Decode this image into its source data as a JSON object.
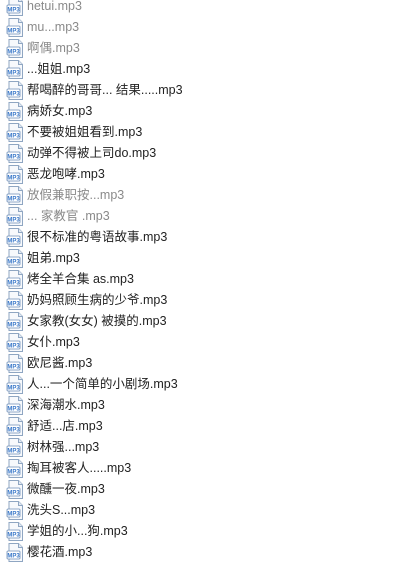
{
  "icon": {
    "type": "mp3-file-icon",
    "label": "MP3",
    "accent": "#3a78c9"
  },
  "files": [
    {
      "name": "hetui.mp3",
      "faded": true
    },
    {
      "name": "mu...mp3",
      "faded": true
    },
    {
      "name": "啊偶.mp3",
      "faded": true
    },
    {
      "name": "...姐姐.mp3",
      "faded": false
    },
    {
      "name": "帮喝醉的哥哥... 结果.....mp3",
      "faded": false
    },
    {
      "name": "病娇女.mp3",
      "faded": false
    },
    {
      "name": "不要被姐姐看到.mp3",
      "faded": false
    },
    {
      "name": "动弹不得被上司do.mp3",
      "faded": false
    },
    {
      "name": "恶龙咆哮.mp3",
      "faded": false
    },
    {
      "name": "放假兼职按...mp3",
      "faded": true
    },
    {
      "name": "... 家教官 .mp3",
      "faded": true
    },
    {
      "name": "很不标准的粤语故事.mp3",
      "faded": false
    },
    {
      "name": "姐弟.mp3",
      "faded": false
    },
    {
      "name": "烤全羊合集 as.mp3",
      "faded": false
    },
    {
      "name": "奶妈照顾生病的少爷.mp3",
      "faded": false
    },
    {
      "name": "女家教(女女) 被摸的.mp3",
      "faded": false
    },
    {
      "name": "女仆.mp3",
      "faded": false
    },
    {
      "name": "欧尼酱.mp3",
      "faded": false
    },
    {
      "name": "人...一个简单的小剧场.mp3",
      "faded": false
    },
    {
      "name": "深海潮水.mp3",
      "faded": false
    },
    {
      "name": "舒适...店.mp3",
      "faded": false
    },
    {
      "name": "树林强...mp3",
      "faded": false
    },
    {
      "name": "掏耳被客人.....mp3",
      "faded": false
    },
    {
      "name": "微醺一夜.mp3",
      "faded": false
    },
    {
      "name": "洗头S...mp3",
      "faded": false
    },
    {
      "name": "学姐的小...狗.mp3",
      "faded": false
    },
    {
      "name": "樱花酒.mp3",
      "faded": false
    }
  ]
}
